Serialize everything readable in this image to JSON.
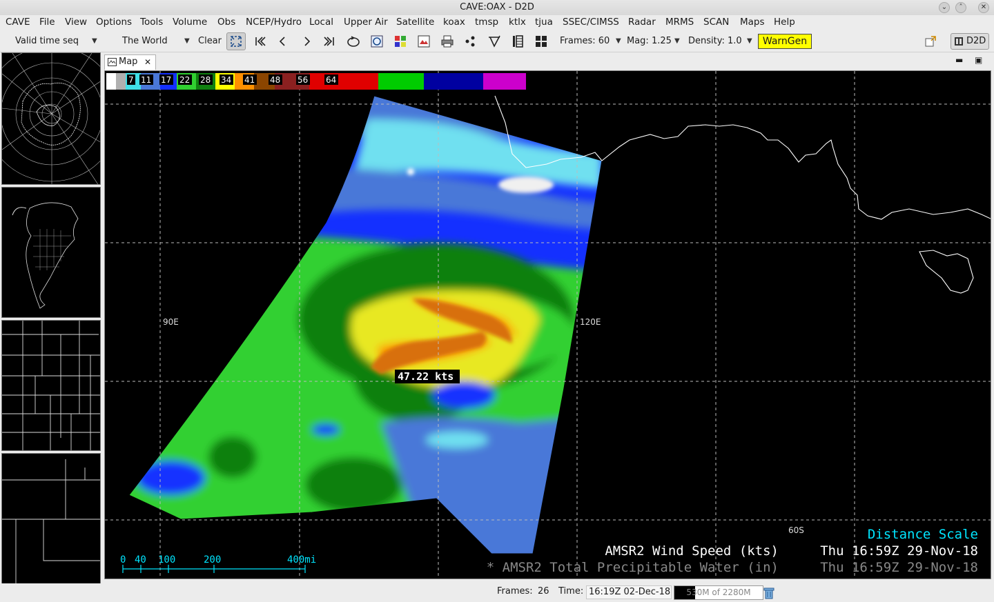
{
  "window": {
    "title": "CAVE:OAX - D2D"
  },
  "menu": [
    "CAVE",
    "File",
    "View",
    "Options",
    "Tools",
    "Volume",
    "Obs",
    "NCEP/Hydro",
    "Local",
    "Upper Air",
    "Satellite",
    "koax",
    "tmsp",
    "ktlx",
    "tjua",
    "SSEC/CIMSS",
    "Radar",
    "MRMS",
    "SCAN",
    "Maps",
    "Help"
  ],
  "toolbar": {
    "time_mode": "Valid time seq",
    "scale": "The World",
    "clear": "Clear",
    "frames": "Frames: 60",
    "mag": "Mag: 1.25",
    "density": "Density: 1.0",
    "warngen": "WarnGen",
    "perspective": "D2D"
  },
  "map_tab": {
    "label": "Map"
  },
  "colorbar": {
    "labels": [
      "7",
      "11",
      "17",
      "22",
      "28",
      "34",
      "41",
      "48",
      "56",
      "64"
    ],
    "colors": [
      "#ffffff",
      "#40e0e8",
      "#4a78d8",
      "#1030ff",
      "#30d030",
      "#108010",
      "#ffff00",
      "#ff9000",
      "#8b4500",
      "#8b2020",
      "#e00000",
      "#00cc00",
      "#0000a0",
      "#cc00cc"
    ]
  },
  "map": {
    "lon_labels": [
      "90E",
      "120E"
    ],
    "lat_labels": [
      "60S"
    ],
    "sample_readout": "47.22 kts",
    "legend_title": "Distance Scale",
    "legend_lines": [
      {
        "product": "AMSR2 Wind Speed (kts)",
        "time": "Thu 16:59Z 29-Nov-18"
      },
      {
        "product": "* AMSR2 Total Precipitable Water (in)",
        "time": "Thu 16:59Z 29-Nov-18"
      }
    ],
    "scale_ticks": [
      "0",
      "40",
      "100",
      "200",
      "400mi"
    ]
  },
  "status": {
    "frames_label": "Frames:",
    "frames_value": "26",
    "time_label": "Time:",
    "time_value": "16:19Z 02-Dec-18",
    "memory": "530M of 2280M",
    "memory_fraction": 0.232
  }
}
